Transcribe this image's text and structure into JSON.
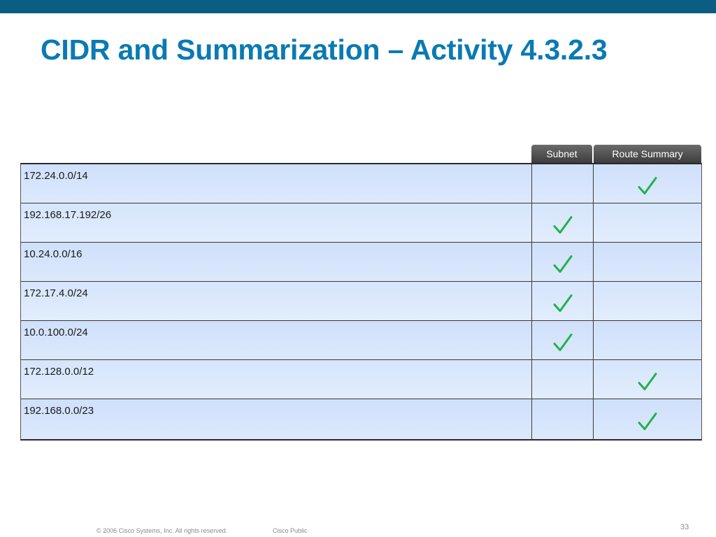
{
  "title": "CIDR and Summarization – Activity 4.3.2.3",
  "colors": {
    "title": "#0a7ab3",
    "top_bar": "#0b5d84",
    "check": "#22b14c"
  },
  "table": {
    "headers": {
      "subnet": "Subnet",
      "route_summary": "Route Summary"
    },
    "rows": [
      {
        "address": "172.24.0.0/14",
        "subnet": false,
        "route_summary": true
      },
      {
        "address": "192.168.17.192/26",
        "subnet": true,
        "route_summary": false
      },
      {
        "address": "10.24.0.0/16",
        "subnet": true,
        "route_summary": false
      },
      {
        "address": "172.17.4.0/24",
        "subnet": true,
        "route_summary": false
      },
      {
        "address": "10.0.100.0/24",
        "subnet": true,
        "route_summary": false
      },
      {
        "address": "172.128.0.0/12",
        "subnet": false,
        "route_summary": true
      },
      {
        "address": "192.168.0.0/23",
        "subnet": false,
        "route_summary": true
      }
    ],
    "check_icon": "checkmark-icon"
  },
  "footer": {
    "copyright": "© 2006 Cisco Systems, Inc. All rights reserved.",
    "classification": "Cisco Public",
    "page_number": "33"
  }
}
